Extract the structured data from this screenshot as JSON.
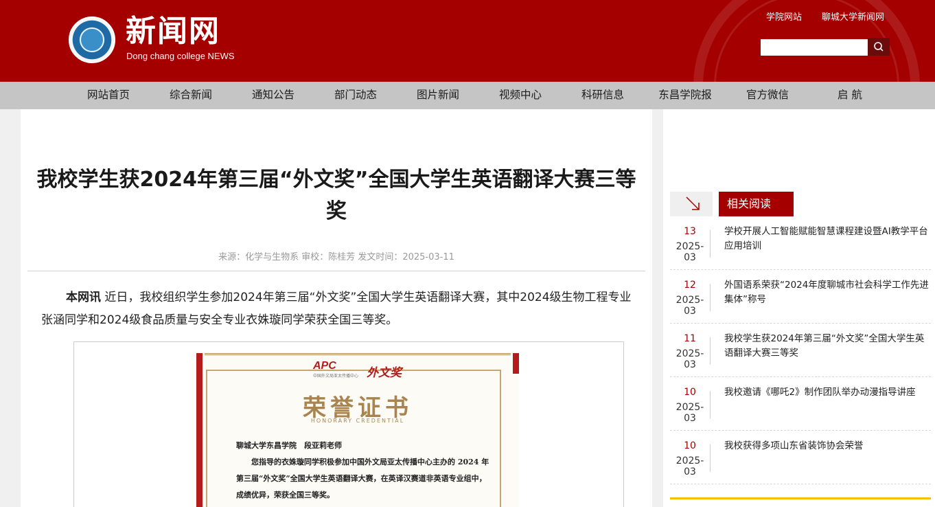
{
  "header": {
    "logo_title": "新闻网",
    "logo_subtitle": "Dong chang college NEWS",
    "links": [
      "学院网站",
      "聊城大学新闻网"
    ],
    "search": {
      "placeholder": "",
      "icon": "search-icon"
    },
    "colors": {
      "brand": "#a40000",
      "nav_bg": "#c5c5c5"
    }
  },
  "nav": {
    "items": [
      "网站首页",
      "综合新闻",
      "通知公告",
      "部门动态",
      "图片新闻",
      "视频中心",
      "科研信息",
      "东昌学院报",
      "官方微信",
      "启 航"
    ]
  },
  "article": {
    "title": "我校学生获2024年第三届“外文奖”全国大学生英语翻译大赛三等奖",
    "meta": "来源：化学与生物系 审校：陈桂芳 发文时间：2025-03-11",
    "lead": "本网讯",
    "body": " 近日，我校组织学生参加2024年第三届“外文奖”全国大学生英语翻译大赛，其中2024级生物工程专业张涵同学和2024级食品质量与安全专业衣姝璇同学荣获全国三等奖。",
    "certificate": {
      "apc": "APC",
      "apc_sub": "中国外文局亚太传播中心",
      "award_name": "外文奖",
      "heading": "荣誉证书",
      "heading_en": "HONORARY CREDENTIAL",
      "lines": [
        "聊城大学东昌学院　段亚莉老师",
        "您指导的衣姝璇同学积极参加中国外文局亚太传播中心主办的 2024 年",
        "第三届“外文奖”全国大学生英语翻译大赛，在英译汉赛道非英语专业组中，",
        "成绩优异，荣获全国三等奖。"
      ]
    }
  },
  "sidebar": {
    "related_label": "相关阅读",
    "items": [
      {
        "day": "13",
        "ym": "2025-03",
        "title": "学校开展人工智能赋能智慧课程建设暨AI教学平台应用培训"
      },
      {
        "day": "12",
        "ym": "2025-03",
        "title": "外国语系荣获“2024年度聊城市社会科学工作先进集体”称号"
      },
      {
        "day": "11",
        "ym": "2025-03",
        "title": "我校学生获2024年第三届“外文奖”全国大学生英语翻译大赛三等奖"
      },
      {
        "day": "10",
        "ym": "2025-03",
        "title": "我校邀请《哪吒2》制作团队举办动漫指导讲座"
      },
      {
        "day": "10",
        "ym": "2025-03",
        "title": "我校获得多项山东省装饰协会荣誉"
      }
    ]
  }
}
